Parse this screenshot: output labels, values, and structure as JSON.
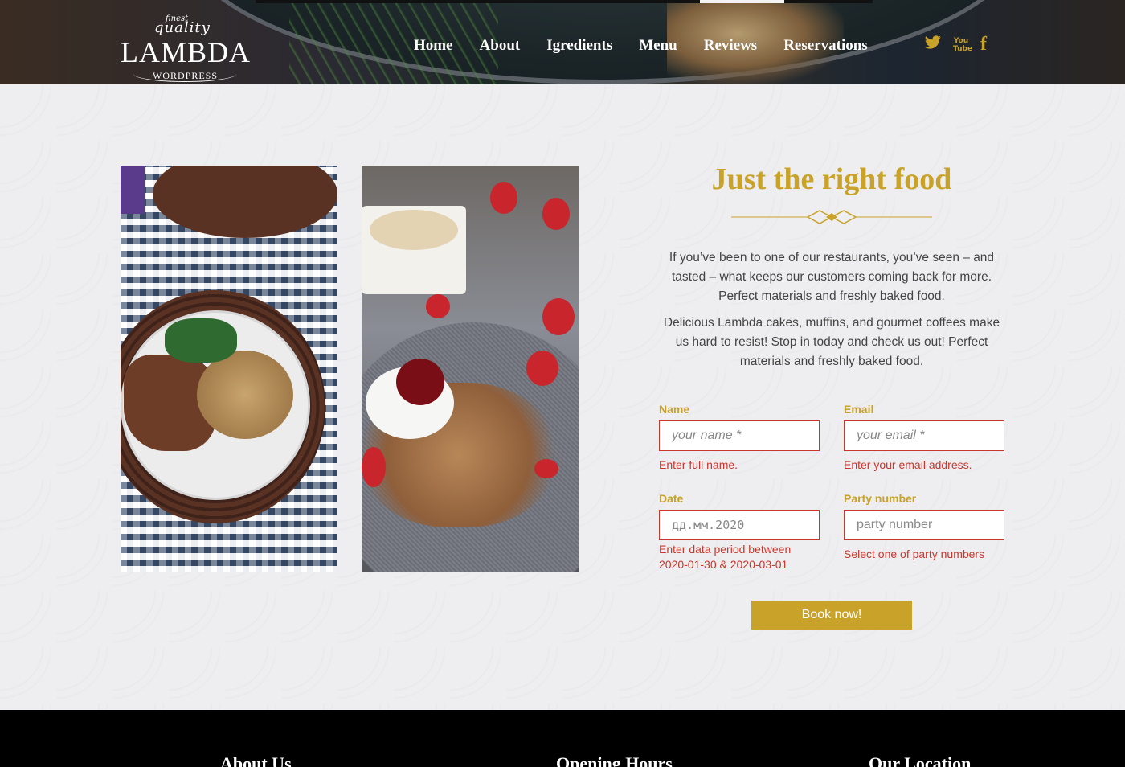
{
  "logo": {
    "small": "finest",
    "quality": "quality",
    "name": "LAMBDA",
    "sub": "WORDPRESS"
  },
  "nav": [
    "Home",
    "About",
    "Igredients",
    "Menu",
    "Reviews",
    "Reservations"
  ],
  "social": {
    "twitter": "twitter-icon",
    "youtube": "You Tube",
    "facebook": "f"
  },
  "section": {
    "heading": "Just the right food",
    "paragraph1": "If you’ve been to one of our restaurants, you’ve seen – and tasted – what keeps our customers coming back for more. Perfect materials and freshly baked food.",
    "paragraph2": "Delicious Lambda cakes, muffins, and gourmet coffees make us hard to resist! Stop in today and check us out! Perfect materials and freshly baked food."
  },
  "form": {
    "name": {
      "label": "Name",
      "placeholder": "your name *",
      "error": "Enter full name."
    },
    "email": {
      "label": "Email",
      "placeholder": "your email *",
      "error": "Enter your email address."
    },
    "date": {
      "label": "Date",
      "placeholder": "дд.мм.2020",
      "error": "Enter data period between 2020-01-30 & 2020-03-01"
    },
    "party": {
      "label": "Party number",
      "placeholder": "party number",
      "error": "Select one of party numbers"
    },
    "submit": "Book now!"
  },
  "footer": {
    "about": "About Us",
    "hours": "Opening Hours",
    "location": "Our Location"
  },
  "colors": {
    "accent": "#c9a22a",
    "error": "#c9372c",
    "footer": "#000000"
  }
}
